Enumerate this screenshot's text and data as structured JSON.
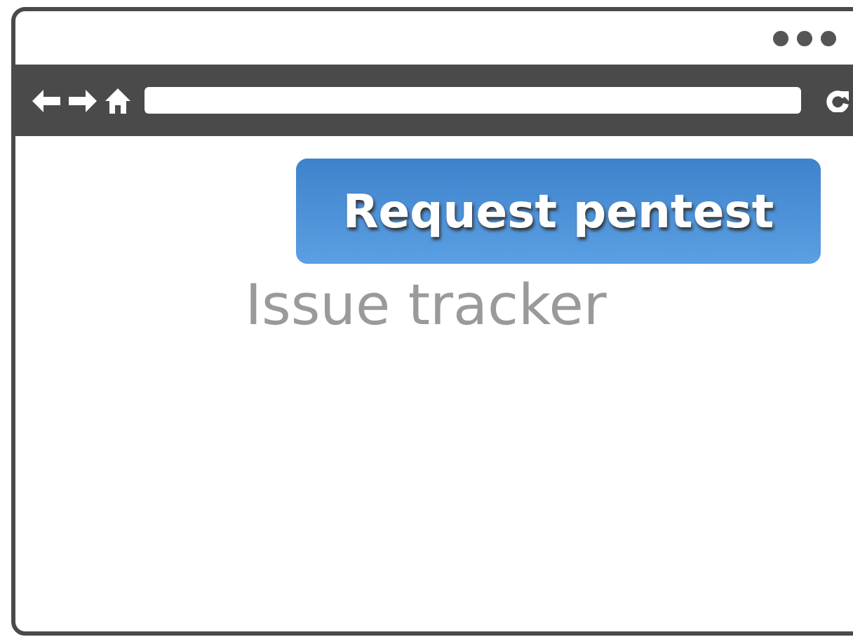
{
  "content": {
    "button_label": "Request pentest",
    "heading": "Issue tracker"
  }
}
